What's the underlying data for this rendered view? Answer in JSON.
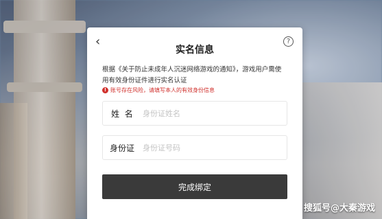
{
  "dialog": {
    "title": "实名信息",
    "back_icon": "chevron-left-icon",
    "help_icon": "question-circle-icon",
    "description": "根据《关于防止未成年人沉迷网络游戏的通知》，游戏用户需使用有效身份证件进行实名认证",
    "warning": "账号存在风险，请填写本人的有效身份信息",
    "warning_icon": "exclamation-circle-icon",
    "name_field": {
      "label": "姓  名",
      "placeholder": "身份证姓名",
      "value": ""
    },
    "id_field": {
      "label": "身份证",
      "placeholder": "身份证号码",
      "value": ""
    },
    "submit_label": "完成绑定"
  },
  "watermark": "搜狐号@大秦游戏",
  "colors": {
    "button_bg": "#3a3a3a",
    "warning": "#d0312d"
  }
}
